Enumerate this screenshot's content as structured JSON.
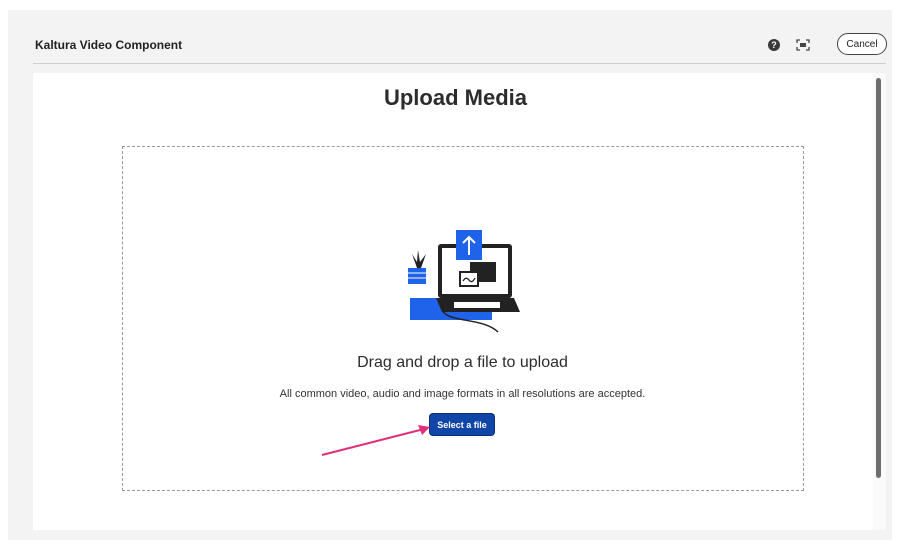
{
  "window": {
    "title": "Kaltura Video Component",
    "help_icon": "question-circle-icon",
    "fullscreen_icon": "fullscreen-icon",
    "cancel_label": "Cancel"
  },
  "upload": {
    "page_title": "Upload Media",
    "illustration_icon": "laptop-upload-illustration",
    "drop_heading": "Drag and drop a file to upload",
    "drop_subtext": "All common video, audio and image formats in all resolutions are accepted.",
    "select_label": "Select a file"
  },
  "annotation": {
    "arrow_color": "#e0307a"
  },
  "colors": {
    "accent": "#1046a8",
    "illustration_blue": "#1e63e9",
    "dark": "#222222"
  }
}
